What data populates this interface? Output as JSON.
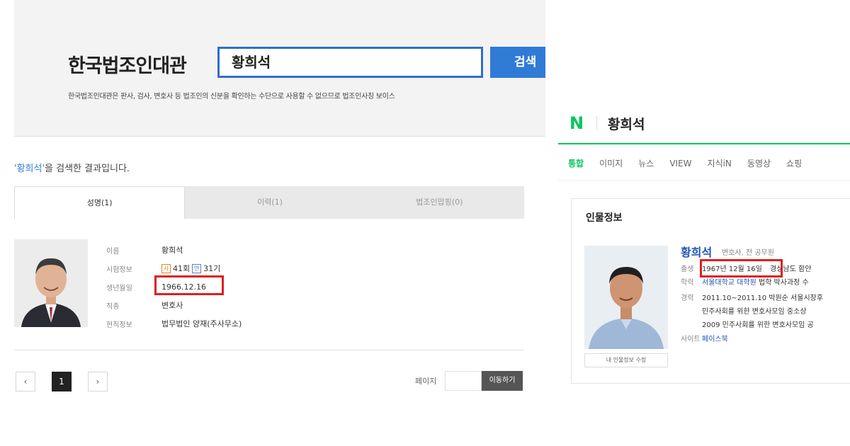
{
  "left": {
    "site_title": "한국법조인대관",
    "search_value": "황희석",
    "search_button": "검색",
    "search_note": "한국법조인대관은 판사, 검사, 변호사 등 법조인의 신분을 확인하는 수단으로 사용할 수 없으므로 법조인사칭 보이스",
    "result_keyword": "'황희석'",
    "result_suffix": "을 검색한 결과입니다.",
    "tabs": [
      "성명(1)",
      "이력(1)",
      "법조인맙핑(0)"
    ],
    "profile": {
      "rows": [
        {
          "label": "이름",
          "value": "황희석"
        },
        {
          "label": "시험정보",
          "badge1": "사",
          "exam1": "41회",
          "badge2": "연",
          "exam2": "31기"
        },
        {
          "label": "생년월일",
          "value": "1966.12.16"
        },
        {
          "label": "직종",
          "value": "변호사"
        },
        {
          "label": "현직정보",
          "value": "법무법인 양재(주사무소)"
        }
      ]
    },
    "pager": {
      "prev": "‹",
      "current": "1",
      "next": "›"
    },
    "page_move_label": "페이지",
    "page_move_button": "이동하기"
  },
  "right": {
    "logo": "N",
    "query": "황희석",
    "tabs": [
      "통합",
      "이미지",
      "뉴스",
      "VIEW",
      "지식iN",
      "동영상",
      "쇼핑"
    ],
    "card_title": "인물정보",
    "person_name": "황희석",
    "person_job": "변호사, 전 공무원",
    "birth_label": "출생",
    "birth_value": "1967년 12월 16일",
    "birth_place": "경상남도 함안",
    "edu_label": "학력",
    "edu_value": "서울대학교 대학원",
    "edu_rest": "법학 박사과정 수",
    "career_label": "경력",
    "career_1": "2011.10~2011.10 박원순 서울시장후",
    "career_2": "민주사회를 위한 변호사모임 중소상",
    "career_3": "2009 민주사회를 위한 변호사모임 공",
    "site_label": "사이트",
    "site_value": "페이스북",
    "edit_button": "내 인물정보 수정"
  }
}
